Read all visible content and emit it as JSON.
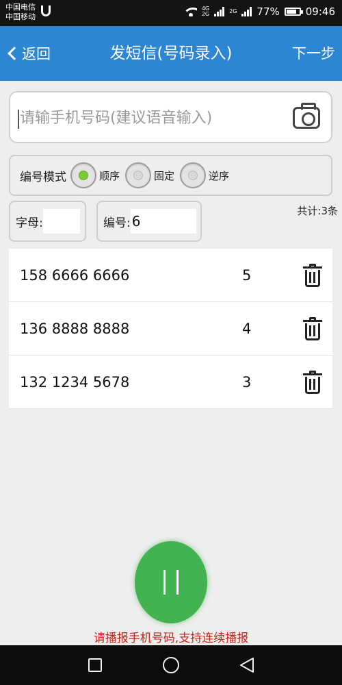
{
  "status_bar": {
    "carrier_1": "中国电信",
    "carrier_2": "中国移动",
    "net_type_top": "4G",
    "net_type_bottom": "2G",
    "net_type_2": "2G",
    "battery": "77%",
    "battery_level": 0.77,
    "time": "09:46",
    "icons": [
      "usb-icon",
      "wifi-icon",
      "signal-icon",
      "battery-icon"
    ]
  },
  "title_bar": {
    "back_label": "返回",
    "title": "发短信(号码录入)",
    "next_label": "下一步",
    "color": "#2c86d3"
  },
  "phone_input": {
    "placeholder": "请输手机号码(建议语音输入)",
    "value": "",
    "icon": "camera-icon"
  },
  "mode": {
    "label": "编号模式",
    "options": [
      {
        "label": "顺序",
        "checked": true
      },
      {
        "label": "固定",
        "checked": false
      },
      {
        "label": "逆序",
        "checked": false
      }
    ],
    "checked_color": "#7ccd35"
  },
  "letter_field": {
    "label": "字母:",
    "value": ""
  },
  "number_field": {
    "label": "编号:",
    "value": "6"
  },
  "total": "共计:3条",
  "phone_list": [
    {
      "number": "158 6666 6666",
      "index": "5"
    },
    {
      "number": "136 8888 8888",
      "index": "4"
    },
    {
      "number": "132 1234 5678",
      "index": "3"
    }
  ],
  "pause_button": {
    "icon": "pause-icon",
    "color": "#43b251"
  },
  "hint": "请播报手机号码,支持连续播报",
  "hint_color": "#c8251d",
  "nav_bar": {
    "icons": [
      "nav-square-icon",
      "nav-home-icon",
      "nav-back-icon"
    ]
  }
}
